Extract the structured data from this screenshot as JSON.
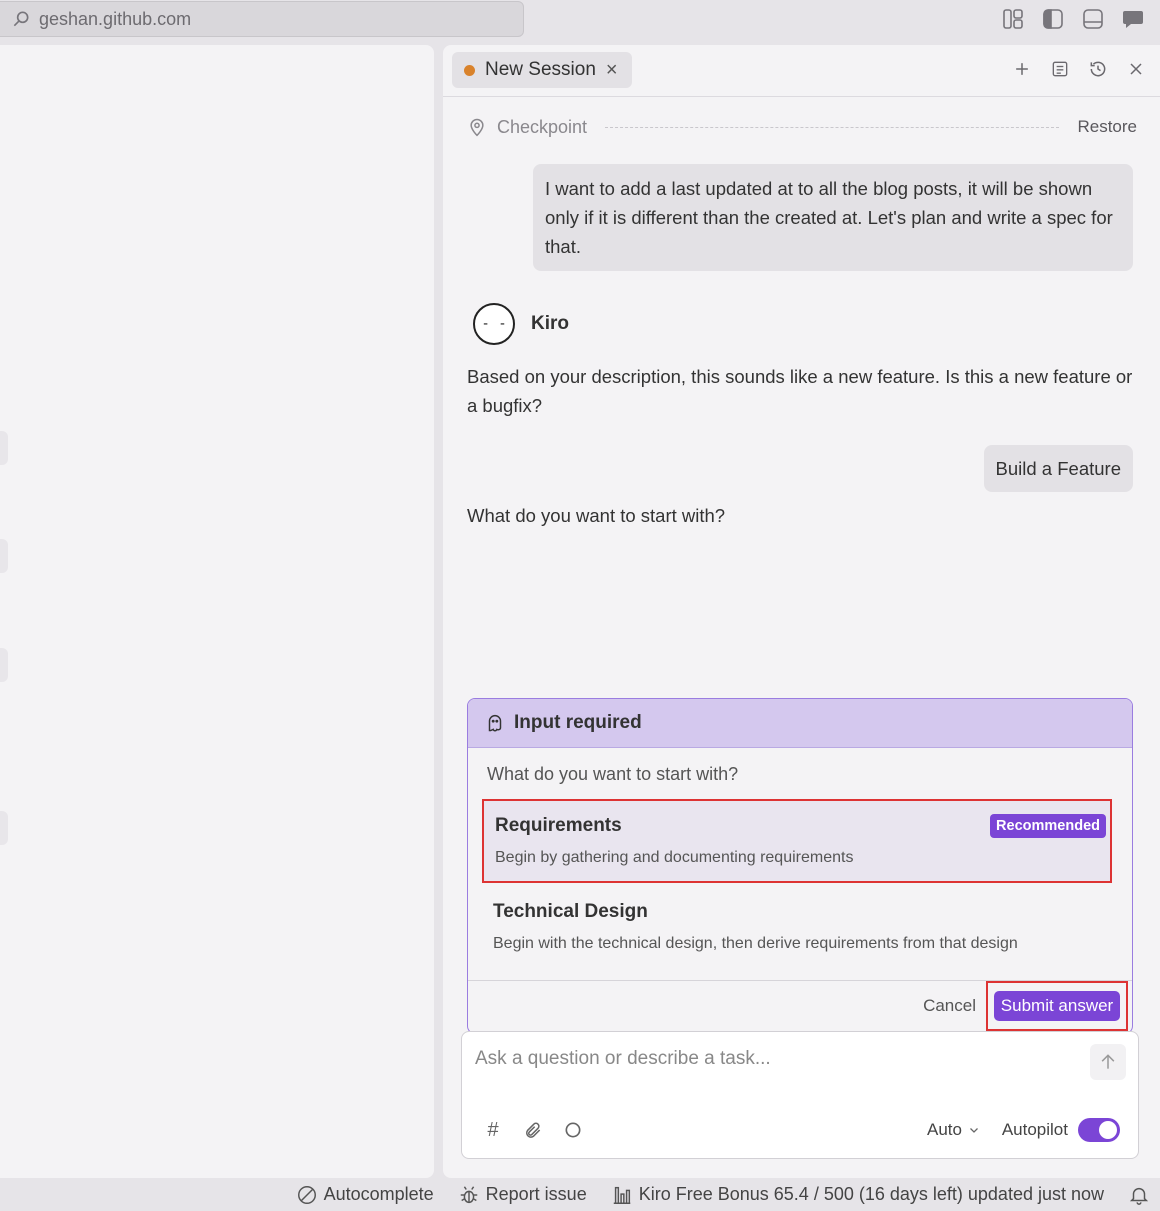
{
  "browser": {
    "address": "geshan.github.com"
  },
  "chat": {
    "tab_label": "New Session",
    "checkpoint_label": "Checkpoint",
    "restore_label": "Restore",
    "user_message": "I want to add a last updated at to all the blog posts, it will be shown only if it is different than the created at. Let's plan and write a spec for that.",
    "assistant_name": "Kiro",
    "avatar_face": "- -",
    "assistant_message": "Based on your description, this sounds like a new feature. Is this a new feature or a bugfix?",
    "user_choice": "Build a Feature",
    "assistant_question": "What do you want to start with?"
  },
  "input_card": {
    "title": "Input required",
    "question": "What do you want to start with?",
    "options": [
      {
        "title": "Requirements",
        "description": "Begin by gathering and documenting requirements",
        "badge": "Recommended"
      },
      {
        "title": "Technical Design",
        "description": "Begin with the technical design, then derive requirements from that design"
      }
    ],
    "cancel_label": "Cancel",
    "submit_label": "Submit answer"
  },
  "composer": {
    "placeholder": "Ask a question or describe a task...",
    "mode_label": "Auto",
    "autopilot_label": "Autopilot",
    "autopilot_on": true
  },
  "statusbar": {
    "autocomplete": "Autocomplete",
    "report_issue": "Report issue",
    "usage": "Kiro Free Bonus 65.4 / 500 (16 days left) updated just now"
  },
  "colors": {
    "accent": "#7b45d6",
    "card_header": "#d4c8ee",
    "tab_dot": "#d9822b",
    "highlight": "#dd3333"
  }
}
